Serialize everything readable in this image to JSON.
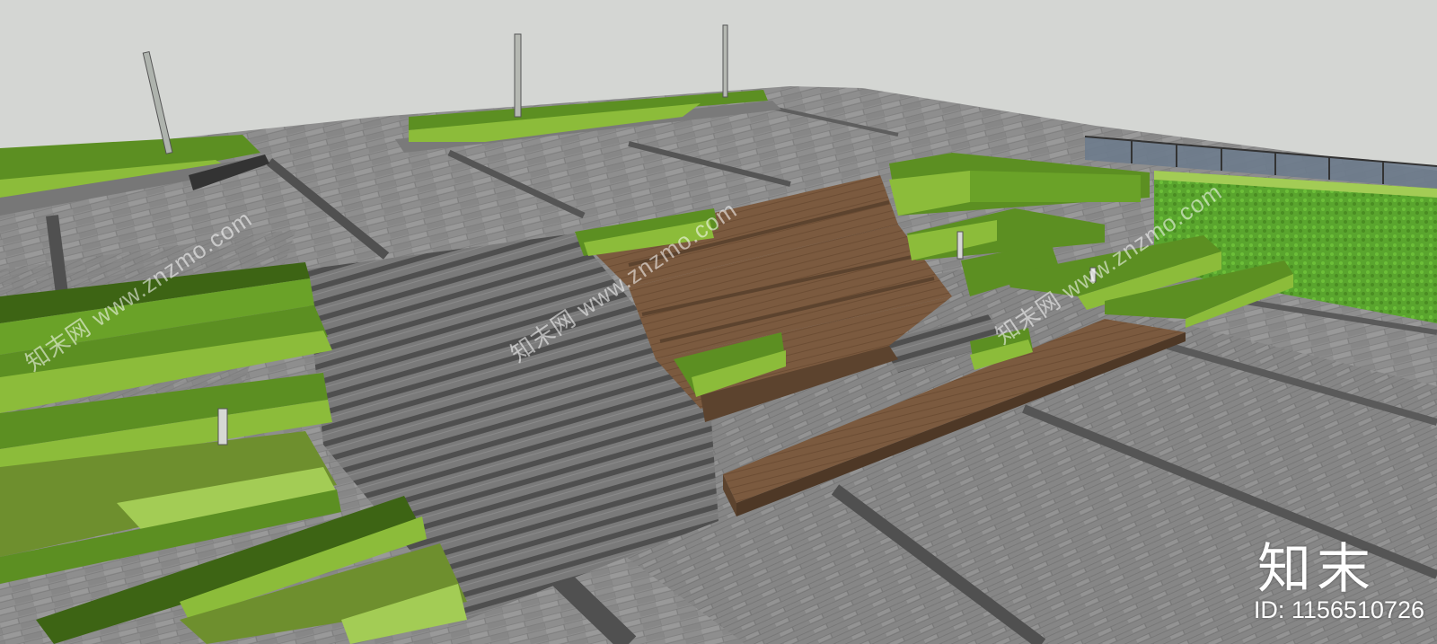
{
  "image": {
    "subject": "sketchup-render-plaza-stepped-seating",
    "colors": {
      "sky": "#d4d6d3",
      "paving": "#8e8e8e",
      "paving_dark": "#6f6f6f",
      "band": "#555555",
      "stairs": "#6e6e6e",
      "wood_top": "#7b5a3f",
      "wood_side": "#5c432e",
      "grass_light": "#8cbc3a",
      "grass_mid": "#5c8f22",
      "grass_dark": "#3d6414",
      "hedge": "#5aa52e",
      "glass": "#6d7b8c"
    }
  },
  "watermark": {
    "diagonal_texts": [
      "知末网 www.znzmo.com",
      "知末网 www.znzmo.com",
      "知末网 www.znzmo.com"
    ],
    "brand": "知末",
    "id_label": "ID: 1156510726"
  }
}
